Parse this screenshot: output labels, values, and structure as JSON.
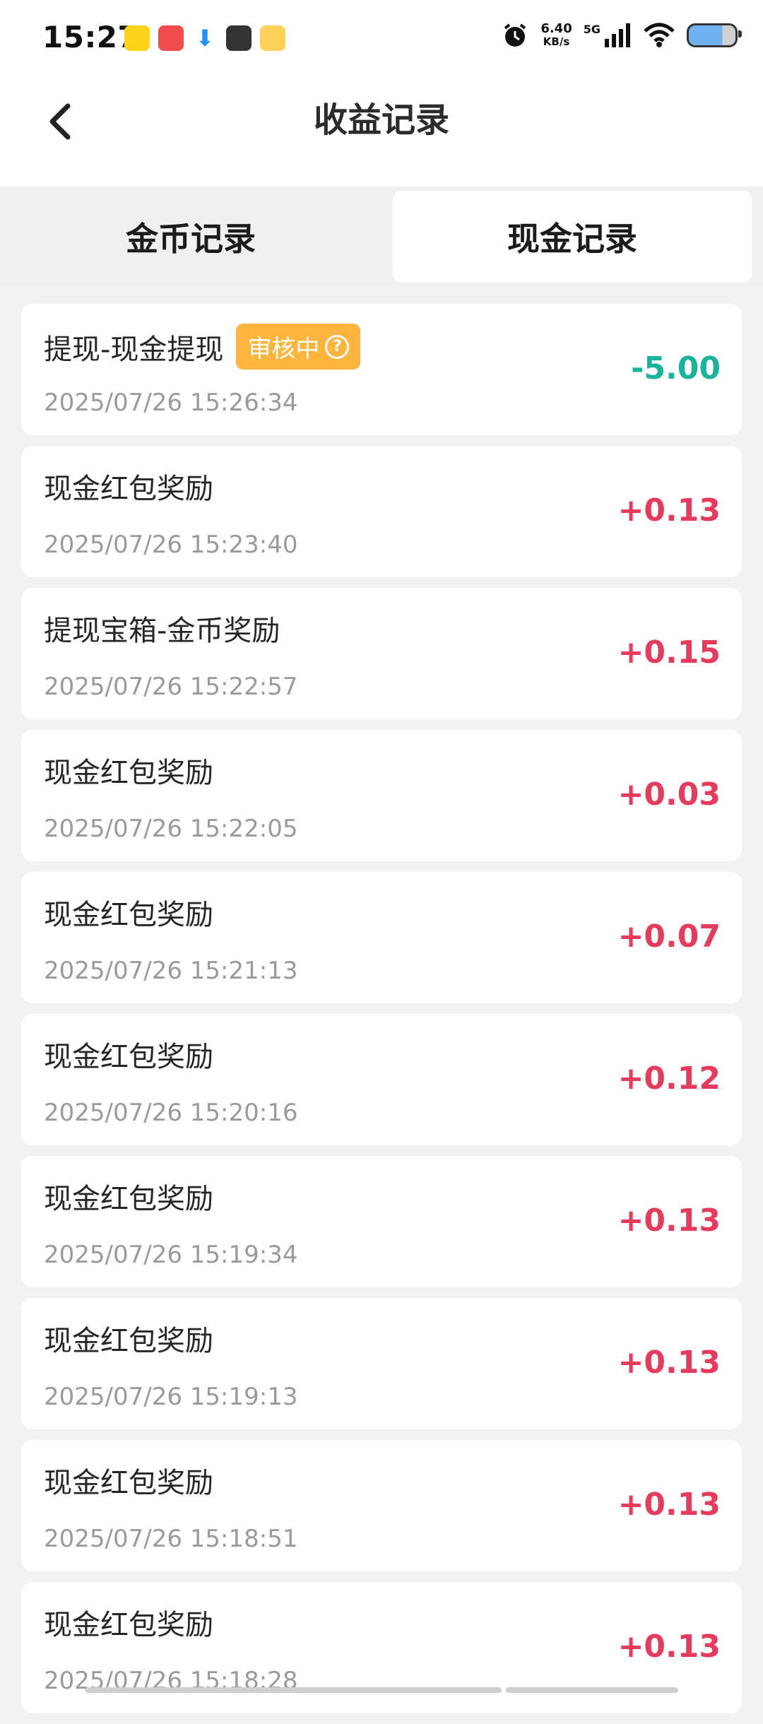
{
  "status_bar": {
    "time": "15:27",
    "net_speed": "6.40",
    "net_unit": "KB/s",
    "network_type": "5G"
  },
  "header": {
    "title": "收益记录"
  },
  "tabs": [
    {
      "label": "金币记录",
      "active": false
    },
    {
      "label": "现金记录",
      "active": true
    }
  ],
  "records": [
    {
      "title": "提现-现金提现",
      "badge": "审核中",
      "time": "2025/07/26 15:26:34",
      "amount": "-5.00",
      "negative": true
    },
    {
      "title": "现金红包奖励",
      "time": "2025/07/26 15:23:40",
      "amount": "+0.13"
    },
    {
      "title": "提现宝箱-金币奖励",
      "time": "2025/07/26 15:22:57",
      "amount": "+0.15"
    },
    {
      "title": "现金红包奖励",
      "time": "2025/07/26 15:22:05",
      "amount": "+0.03"
    },
    {
      "title": "现金红包奖励",
      "time": "2025/07/26 15:21:13",
      "amount": "+0.07"
    },
    {
      "title": "现金红包奖励",
      "time": "2025/07/26 15:20:16",
      "amount": "+0.12"
    },
    {
      "title": "现金红包奖励",
      "time": "2025/07/26 15:19:34",
      "amount": "+0.13"
    },
    {
      "title": "现金红包奖励",
      "time": "2025/07/26 15:19:13",
      "amount": "+0.13"
    },
    {
      "title": "现金红包奖励",
      "time": "2025/07/26 15:18:51",
      "amount": "+0.13"
    },
    {
      "title": "现金红包奖励",
      "time": "2025/07/26 15:18:28",
      "amount": "+0.13"
    }
  ],
  "colors": {
    "positive": "#e63b5c",
    "negative": "#1ab49d",
    "badge": "#ffb43d"
  },
  "icons": {
    "back": "chevron-left-icon",
    "badge_help": "question-circle-icon"
  }
}
